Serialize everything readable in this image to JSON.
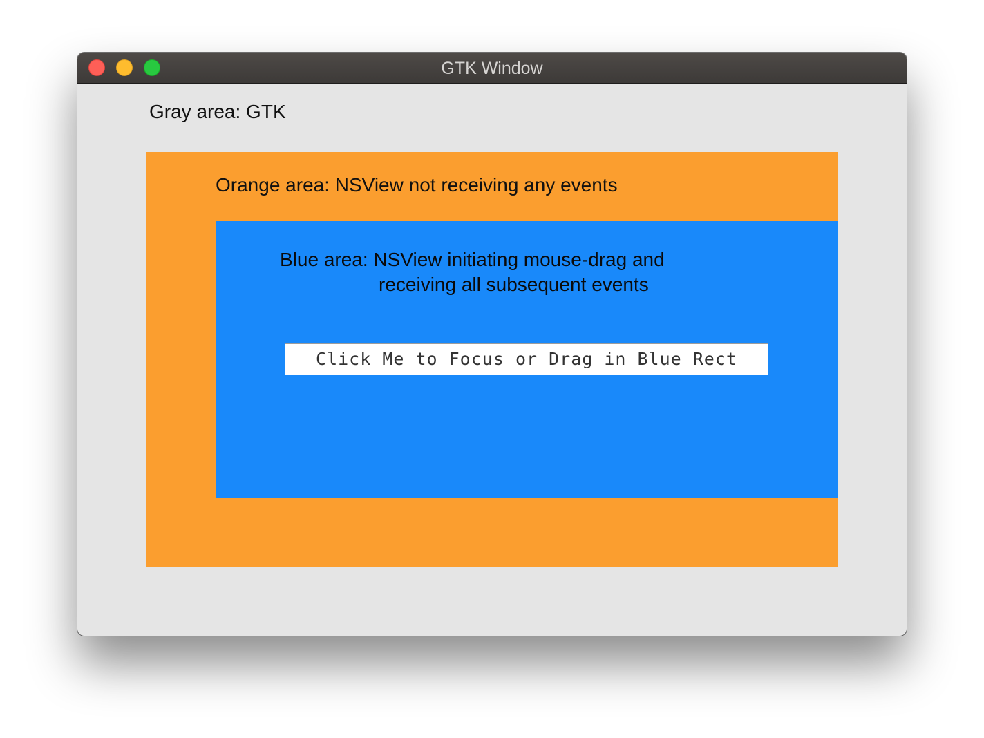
{
  "window": {
    "title": "GTK Window",
    "controls": [
      "close",
      "minimize",
      "maximize"
    ]
  },
  "gray_area": {
    "label": "Gray area: GTK",
    "color": "#e5e5e5"
  },
  "orange_area": {
    "label": "Orange area: NSView not receiving any events",
    "color": "#fb9e2f"
  },
  "blue_area": {
    "label_line1": "Blue area: NSView initiating mouse-drag and",
    "label_line2": "receiving all subsequent events",
    "color": "#1989fa",
    "button_label": "Click Me to Focus or Drag in Blue Rect"
  }
}
